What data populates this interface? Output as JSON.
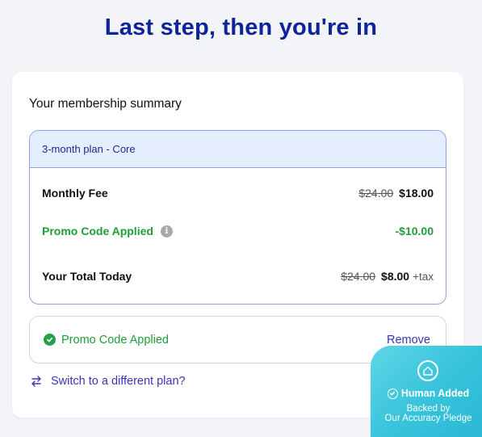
{
  "header": {
    "title": "Last step, then you're in"
  },
  "summary": {
    "title": "Your membership summary",
    "plan_name": "3-month plan - Core",
    "rows": {
      "fee": {
        "label": "Monthly Fee",
        "original": "$24.00",
        "price": "$18.00"
      },
      "promo": {
        "label": "Promo Code Applied",
        "info_icon": "i",
        "discount": "-$10.00"
      },
      "total": {
        "label": "Your Total Today",
        "original": "$24.00",
        "price": "$8.00",
        "suffix": "+tax"
      }
    }
  },
  "promo": {
    "status": "Promo Code Applied",
    "remove_label": "Remove"
  },
  "switch_plan": {
    "label": "Switch to a different plan?"
  },
  "badge": {
    "title": "Human Added",
    "line1": "Backed by",
    "line2": "Our Accuracy Pledge"
  },
  "colors": {
    "headline": "#0f239b",
    "accent_green": "#1f9d3a",
    "link": "#3a34b8",
    "plan_border": "#8da3e8",
    "plan_header_bg": "#e5eefe",
    "badge_bg": "#38c4dc"
  },
  "icons": [
    "info-icon",
    "check-circle-icon",
    "swap-arrows-icon",
    "home-shield-icon",
    "badge-check-icon"
  ]
}
